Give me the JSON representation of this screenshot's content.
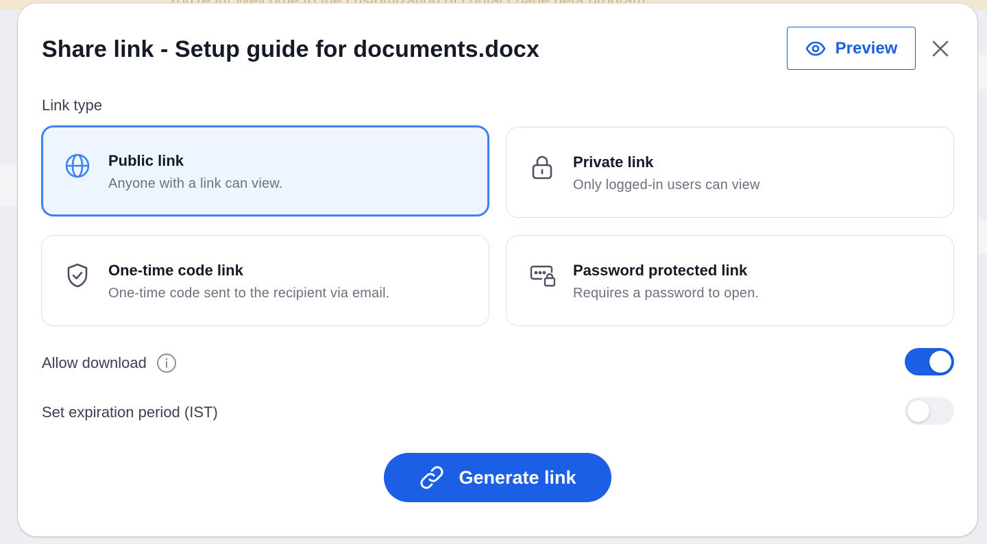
{
  "background": {
    "banner_text": "You're in! Welcome to the customization of contact page beta program"
  },
  "dialog": {
    "title": "Share link - Setup guide for documents.docx",
    "preview_label": "Preview",
    "close_icon": "close-icon"
  },
  "link_type": {
    "label": "Link type",
    "options": [
      {
        "title": "Public link",
        "description": "Anyone with a link can view.",
        "icon": "globe-icon",
        "selected": true
      },
      {
        "title": "Private link",
        "description": "Only logged-in users can view",
        "icon": "lock-icon",
        "selected": false
      },
      {
        "title": "One-time code link",
        "description": "One-time code sent to the recipient via email.",
        "icon": "shield-check-icon",
        "selected": false
      },
      {
        "title": "Password protected link",
        "description": "Requires a password to open.",
        "icon": "password-lock-icon",
        "selected": false
      }
    ]
  },
  "settings": {
    "allow_download": {
      "label": "Allow download",
      "enabled": true,
      "icon": "info-icon"
    },
    "expiration": {
      "label": "Set expiration period (IST)",
      "enabled": false
    }
  },
  "actions": {
    "generate_label": "Generate link",
    "generate_icon": "link-icon"
  },
  "colors": {
    "accent": "#1a5fe6",
    "selected_border": "#3b82f6",
    "selected_bg": "#eff5ff"
  }
}
